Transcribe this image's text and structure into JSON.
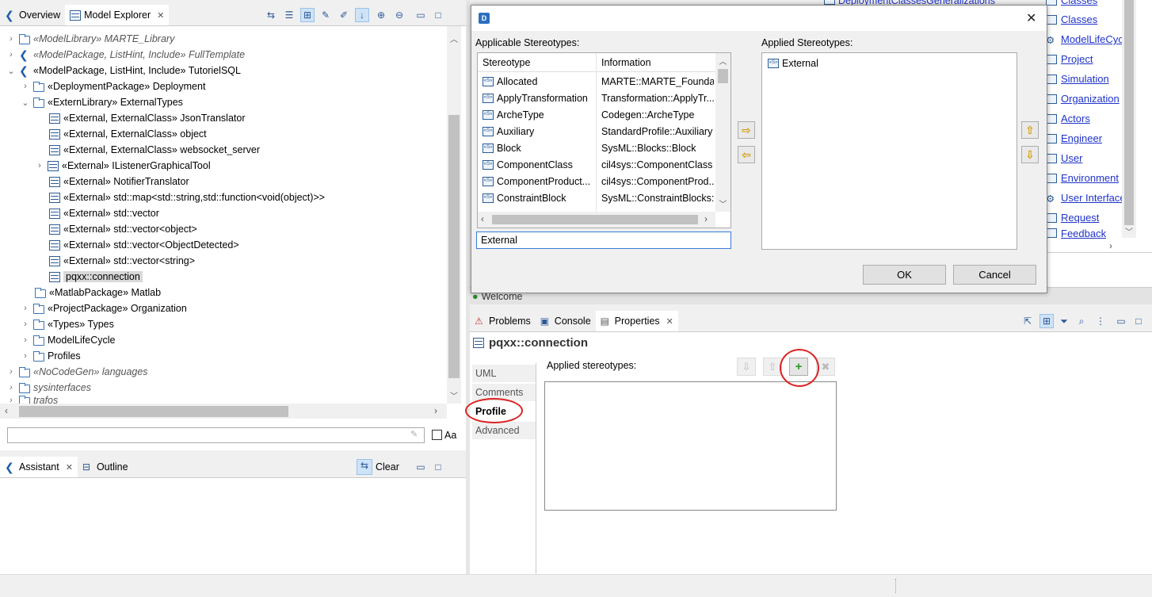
{
  "explorer": {
    "tabs": [
      {
        "label": "Overview"
      },
      {
        "label": "Model Explorer"
      }
    ],
    "tree": [
      {
        "label": "«ModelLibrary» MARTE_Library",
        "italic": true
      },
      {
        "label": "«ModelPackage, ListHint, Include» FullTemplate",
        "italic": true
      },
      {
        "label": "«ModelPackage, ListHint, Include» TutorielSQL",
        "italic": false
      },
      {
        "label": "«DeploymentPackage» Deployment"
      },
      {
        "label": "«ExternLibrary» ExternalTypes"
      },
      {
        "label": "«External, ExternalClass» JsonTranslator"
      },
      {
        "label": "«External, ExternalClass» object"
      },
      {
        "label": "«External, ExternalClass» websocket_server"
      },
      {
        "label": "«External» IListenerGraphicalTool"
      },
      {
        "label": "«External» NotifierTranslator"
      },
      {
        "label": "«External» std::map<std::string,std::function<void(object)>>"
      },
      {
        "label": "«External» std::vector"
      },
      {
        "label": "«External» std::vector<object>"
      },
      {
        "label": "«External» std::vector<ObjectDetected>"
      },
      {
        "label": "«External» std::vector<string>"
      },
      {
        "label": "pqxx::connection"
      },
      {
        "label": "«MatlabPackage» Matlab"
      },
      {
        "label": "«ProjectPackage» Organization"
      },
      {
        "label": "«Types» Types"
      },
      {
        "label": "ModelLifeCycle"
      },
      {
        "label": "Profiles"
      },
      {
        "label": "«NoCodeGen» languages",
        "italic": true
      },
      {
        "label": "sysinterfaces",
        "italic": true
      },
      {
        "label": "trafos",
        "italic": true
      }
    ],
    "filter_value": "",
    "case_label": "Aa"
  },
  "assistant": {
    "tabs": [
      {
        "label": "Assistant"
      },
      {
        "label": "Outline"
      }
    ],
    "clear_label": "Clear"
  },
  "dialog": {
    "applicable_label": "Applicable Stereotypes:",
    "applied_label": "Applied Stereotypes:",
    "col_stereotype": "Stereotype",
    "col_information": "Information",
    "stereotypes": [
      {
        "name": "Allocated",
        "info": "MARTE::MARTE_Foundat..."
      },
      {
        "name": "ApplyTransformation",
        "info": "Transformation::ApplyTr..."
      },
      {
        "name": "ArcheType",
        "info": "Codegen::ArcheType"
      },
      {
        "name": "Auxiliary",
        "info": "StandardProfile::Auxiliary"
      },
      {
        "name": "Block",
        "info": "SysML::Blocks::Block"
      },
      {
        "name": "ComponentClass",
        "info": "cil4sys::ComponentClass"
      },
      {
        "name": "ComponentProduct...",
        "info": "cil4sys::ComponentProd..."
      },
      {
        "name": "ConstraintBlock",
        "info": "SysML::ConstraintBlocks:..."
      }
    ],
    "filter_value": "External",
    "applied": [
      {
        "name": "External"
      }
    ],
    "ok_label": "OK",
    "cancel_label": "Cancel"
  },
  "right_links": [
    {
      "label": "DeploymentClassesGeneralizations",
      "left": true
    },
    {
      "label": "Classes"
    },
    {
      "label": "Classes"
    },
    {
      "label": "ModelLifeCyc"
    },
    {
      "label": "Project"
    },
    {
      "label": "Simulation"
    },
    {
      "label": "Organization"
    },
    {
      "label": "Actors"
    },
    {
      "label": "Engineer"
    },
    {
      "label": "User"
    },
    {
      "label": "Environment"
    },
    {
      "label": "User Interface"
    },
    {
      "label": "Request"
    },
    {
      "label": "Feedback"
    }
  ],
  "welcome_tab": "Welcome",
  "bottom": {
    "tabs": [
      {
        "label": "Problems"
      },
      {
        "label": "Console"
      },
      {
        "label": "Properties"
      }
    ],
    "element_title": "pqxx::connection",
    "side_tabs": [
      {
        "label": "UML"
      },
      {
        "label": "Comments"
      },
      {
        "label": "Profile"
      },
      {
        "label": "Advanced"
      }
    ],
    "applied_stereotypes_label": "Applied stereotypes:"
  },
  "colors": {
    "link": "#1f33c9",
    "annotation_ring": "#d22222",
    "selection": "#cfe3f7"
  }
}
